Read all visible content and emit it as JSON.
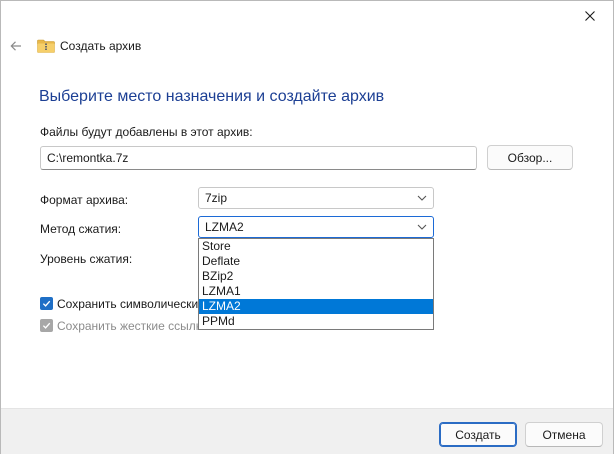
{
  "window": {
    "title": "Создать архив",
    "close_glyph": "✕"
  },
  "main": {
    "heading": "Выберите место назначения и создайте архив",
    "files_label": "Файлы будут добавлены в этот архив:",
    "path_value": "C:\\remontka.7z",
    "browse_label": "Обзор...",
    "format_label": "Формат архива:",
    "format_value": "7zip",
    "method_label": "Метод сжатия:",
    "method_value": "LZMA2",
    "level_label": "Уровень сжатия:",
    "method_options": [
      "Store",
      "Deflate",
      "BZip2",
      "LZMA1",
      "LZMA2",
      "PPMd"
    ],
    "method_selected_index": 4,
    "symlinks_label": "Сохранить символические ссылки",
    "symlinks_checked": true,
    "hardlinks_label": "Сохранить жесткие ссылки",
    "hardlinks_checked": true,
    "hardlinks_enabled": false
  },
  "footer": {
    "create_label": "Создать",
    "cancel_label": "Отмена"
  },
  "colors": {
    "heading": "#1c3f94",
    "accent": "#0078d7",
    "checkbox_on": "#1f6fc6",
    "checkbox_disabled": "#a7a7a7",
    "footer_bg": "#f0f0f0"
  },
  "icons": {
    "back": "arrow-left-icon",
    "folder": "zip-folder-icon",
    "close": "close-icon",
    "chevron": "chevron-down-icon",
    "check": "checkmark-icon"
  }
}
